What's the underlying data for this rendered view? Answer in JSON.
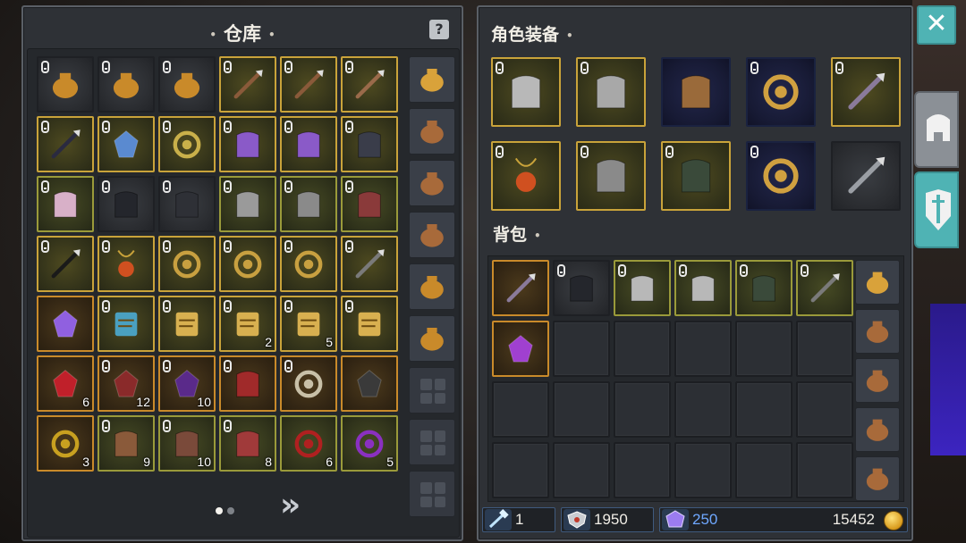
{
  "warehouse": {
    "title": "仓库",
    "help_label": "?",
    "items": [
      {
        "icon": "gold-pouch-icon",
        "border": "dark",
        "locked": true,
        "qty": ""
      },
      {
        "icon": "gold-pouch-icon",
        "border": "dark",
        "locked": true,
        "qty": ""
      },
      {
        "icon": "gold-pouch-icon",
        "border": "dark",
        "locked": true,
        "qty": ""
      },
      {
        "icon": "horn-bow-icon",
        "border": "gold",
        "locked": true,
        "qty": ""
      },
      {
        "icon": "horn-bow-icon",
        "border": "gold",
        "locked": true,
        "qty": ""
      },
      {
        "icon": "recurve-bow-icon",
        "border": "gold",
        "locked": true,
        "qty": ""
      },
      {
        "icon": "dark-spear-icon",
        "border": "gold",
        "locked": true,
        "qty": ""
      },
      {
        "icon": "crystal-shield-icon",
        "border": "gold",
        "locked": true,
        "qty": ""
      },
      {
        "icon": "gem-ring-icon",
        "border": "gold",
        "locked": true,
        "qty": ""
      },
      {
        "icon": "purple-armor-icon",
        "border": "gold",
        "locked": true,
        "qty": ""
      },
      {
        "icon": "purple-armor-icon",
        "border": "gold",
        "locked": true,
        "qty": ""
      },
      {
        "icon": "dark-helmet-icon",
        "border": "gold",
        "locked": true,
        "qty": ""
      },
      {
        "icon": "pink-helmet-icon",
        "border": "olive",
        "locked": true,
        "qty": ""
      },
      {
        "icon": "black-chest-icon",
        "border": "dark",
        "locked": true,
        "qty": ""
      },
      {
        "icon": "chainmail-icon",
        "border": "dark",
        "locked": true,
        "qty": ""
      },
      {
        "icon": "steel-armor-icon",
        "border": "olive",
        "locked": true,
        "qty": ""
      },
      {
        "icon": "gauntlet-icon",
        "border": "olive",
        "locked": true,
        "qty": ""
      },
      {
        "icon": "red-armor-icon",
        "border": "olive",
        "locked": true,
        "qty": ""
      },
      {
        "icon": "black-sword-icon",
        "border": "gold",
        "locked": true,
        "qty": ""
      },
      {
        "icon": "ruby-amulet-icon",
        "border": "gold",
        "locked": true,
        "qty": ""
      },
      {
        "icon": "teal-ring-icon",
        "border": "gold",
        "locked": true,
        "qty": ""
      },
      {
        "icon": "teal-ring-icon",
        "border": "gold",
        "locked": true,
        "qty": ""
      },
      {
        "icon": "teal-ring-icon",
        "border": "gold",
        "locked": true,
        "qty": ""
      },
      {
        "icon": "long-spear-icon",
        "border": "gold",
        "locked": true,
        "qty": ""
      },
      {
        "icon": "purple-gem-icon",
        "border": "orange",
        "locked": false,
        "qty": ""
      },
      {
        "icon": "magic-scroll-icon",
        "border": "gold",
        "locked": true,
        "qty": ""
      },
      {
        "icon": "scroll-icon",
        "border": "gold",
        "locked": true,
        "qty": ""
      },
      {
        "icon": "scroll-icon",
        "border": "gold",
        "locked": true,
        "qty": "2"
      },
      {
        "icon": "scroll-icon",
        "border": "gold",
        "locked": true,
        "qty": "5"
      },
      {
        "icon": "scroll-icon",
        "border": "gold",
        "locked": true,
        "qty": ""
      },
      {
        "icon": "red-crystal-icon",
        "border": "orange",
        "locked": false,
        "qty": "6"
      },
      {
        "icon": "red-ore-icon",
        "border": "orange",
        "locked": true,
        "qty": "12"
      },
      {
        "icon": "purple-ore-icon",
        "border": "orange",
        "locked": true,
        "qty": "10"
      },
      {
        "icon": "red-claw-icon",
        "border": "orange",
        "locked": true,
        "qty": ""
      },
      {
        "icon": "glass-orb-icon",
        "border": "orange",
        "locked": true,
        "qty": ""
      },
      {
        "icon": "dark-ore-icon",
        "border": "orange",
        "locked": false,
        "qty": ""
      },
      {
        "icon": "swirl-orb-icon",
        "border": "orange",
        "locked": false,
        "qty": "3"
      },
      {
        "icon": "dragon-scale-icon",
        "border": "olive",
        "locked": true,
        "qty": "9"
      },
      {
        "icon": "bone-claw-icon",
        "border": "olive",
        "locked": true,
        "qty": "10"
      },
      {
        "icon": "red-spine-icon",
        "border": "olive",
        "locked": true,
        "qty": "8"
      },
      {
        "icon": "red-flower-icon",
        "border": "olive",
        "locked": false,
        "qty": "6"
      },
      {
        "icon": "purple-swirl-icon",
        "border": "olive",
        "locked": false,
        "qty": "5"
      }
    ],
    "side_bags": [
      "backpack-icon",
      "pouch-icon",
      "pouch-icon",
      "pouch-icon",
      "gold-pouch-icon",
      "gold-pouch-icon",
      "empty",
      "empty",
      "empty"
    ],
    "page_dots": [
      "on",
      "off"
    ],
    "next_label": "»"
  },
  "equipment": {
    "title": "角色装备",
    "items": [
      {
        "icon": "knight-helmet-icon",
        "border": "gold",
        "locked": true
      },
      {
        "icon": "plate-chest-icon",
        "border": "gold",
        "locked": true
      },
      {
        "icon": "leather-armor-icon",
        "border": "blue",
        "locked": false
      },
      {
        "icon": "gold-ring-icon",
        "border": "blue",
        "locked": true
      },
      {
        "icon": "battle-axe-icon",
        "border": "gold",
        "locked": true
      },
      {
        "icon": "ruby-amulet-icon",
        "border": "gold",
        "locked": true
      },
      {
        "icon": "gauntlet-icon",
        "border": "gold",
        "locked": true
      },
      {
        "icon": "clawed-boots-icon",
        "border": "gold",
        "locked": true
      },
      {
        "icon": "gold-ring-icon",
        "border": "blue",
        "locked": true
      },
      {
        "icon": "sword-slot-icon",
        "border": "dark",
        "locked": false
      }
    ]
  },
  "backpack": {
    "title": "背包",
    "items": [
      {
        "icon": "battle-axe-icon",
        "border": "orange",
        "locked": false
      },
      {
        "icon": "black-chest-icon",
        "border": "dark",
        "locked": true
      },
      {
        "icon": "knight-helmet-icon",
        "border": "olive",
        "locked": true
      },
      {
        "icon": "knight-helmet-icon",
        "border": "olive",
        "locked": true
      },
      {
        "icon": "clawed-boots-icon",
        "border": "olive",
        "locked": true
      },
      {
        "icon": "long-spear-icon",
        "border": "olive",
        "locked": true
      },
      {
        "icon": "purple-potion-icon",
        "border": "orange",
        "locked": false
      },
      {
        "icon": "empty"
      },
      {
        "icon": "empty"
      },
      {
        "icon": "empty"
      },
      {
        "icon": "empty"
      },
      {
        "icon": "empty"
      },
      {
        "icon": "empty"
      },
      {
        "icon": "empty"
      },
      {
        "icon": "empty"
      },
      {
        "icon": "empty"
      },
      {
        "icon": "empty"
      },
      {
        "icon": "empty"
      },
      {
        "icon": "empty"
      },
      {
        "icon": "empty"
      },
      {
        "icon": "empty"
      },
      {
        "icon": "empty"
      },
      {
        "icon": "empty"
      },
      {
        "icon": "empty"
      }
    ],
    "side_bags": [
      "backpack-icon",
      "pouch-icon",
      "pouch-icon",
      "pouch-icon",
      "pouch-icon"
    ]
  },
  "status": {
    "hammer_value": "1",
    "shield_value": "1950",
    "gem_value": "250",
    "gold_value": "15452"
  },
  "close_label": "✕",
  "colors": {
    "accent_teal": "#4fb3b4",
    "gem_blue": "#6fa8ff",
    "rare_gold": "#c9a33a"
  }
}
